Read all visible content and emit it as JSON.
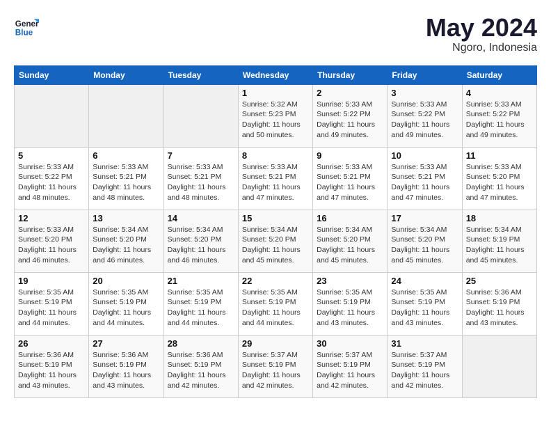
{
  "header": {
    "logo_general": "General",
    "logo_blue": "Blue",
    "month_year": "May 2024",
    "location": "Ngoro, Indonesia"
  },
  "days_of_week": [
    "Sunday",
    "Monday",
    "Tuesday",
    "Wednesday",
    "Thursday",
    "Friday",
    "Saturday"
  ],
  "weeks": [
    [
      {
        "day": "",
        "info": ""
      },
      {
        "day": "",
        "info": ""
      },
      {
        "day": "",
        "info": ""
      },
      {
        "day": "1",
        "info": "Sunrise: 5:32 AM\nSunset: 5:23 PM\nDaylight: 11 hours\nand 50 minutes."
      },
      {
        "day": "2",
        "info": "Sunrise: 5:33 AM\nSunset: 5:22 PM\nDaylight: 11 hours\nand 49 minutes."
      },
      {
        "day": "3",
        "info": "Sunrise: 5:33 AM\nSunset: 5:22 PM\nDaylight: 11 hours\nand 49 minutes."
      },
      {
        "day": "4",
        "info": "Sunrise: 5:33 AM\nSunset: 5:22 PM\nDaylight: 11 hours\nand 49 minutes."
      }
    ],
    [
      {
        "day": "5",
        "info": "Sunrise: 5:33 AM\nSunset: 5:22 PM\nDaylight: 11 hours\nand 48 minutes."
      },
      {
        "day": "6",
        "info": "Sunrise: 5:33 AM\nSunset: 5:21 PM\nDaylight: 11 hours\nand 48 minutes."
      },
      {
        "day": "7",
        "info": "Sunrise: 5:33 AM\nSunset: 5:21 PM\nDaylight: 11 hours\nand 48 minutes."
      },
      {
        "day": "8",
        "info": "Sunrise: 5:33 AM\nSunset: 5:21 PM\nDaylight: 11 hours\nand 47 minutes."
      },
      {
        "day": "9",
        "info": "Sunrise: 5:33 AM\nSunset: 5:21 PM\nDaylight: 11 hours\nand 47 minutes."
      },
      {
        "day": "10",
        "info": "Sunrise: 5:33 AM\nSunset: 5:21 PM\nDaylight: 11 hours\nand 47 minutes."
      },
      {
        "day": "11",
        "info": "Sunrise: 5:33 AM\nSunset: 5:20 PM\nDaylight: 11 hours\nand 47 minutes."
      }
    ],
    [
      {
        "day": "12",
        "info": "Sunrise: 5:33 AM\nSunset: 5:20 PM\nDaylight: 11 hours\nand 46 minutes."
      },
      {
        "day": "13",
        "info": "Sunrise: 5:34 AM\nSunset: 5:20 PM\nDaylight: 11 hours\nand 46 minutes."
      },
      {
        "day": "14",
        "info": "Sunrise: 5:34 AM\nSunset: 5:20 PM\nDaylight: 11 hours\nand 46 minutes."
      },
      {
        "day": "15",
        "info": "Sunrise: 5:34 AM\nSunset: 5:20 PM\nDaylight: 11 hours\nand 45 minutes."
      },
      {
        "day": "16",
        "info": "Sunrise: 5:34 AM\nSunset: 5:20 PM\nDaylight: 11 hours\nand 45 minutes."
      },
      {
        "day": "17",
        "info": "Sunrise: 5:34 AM\nSunset: 5:20 PM\nDaylight: 11 hours\nand 45 minutes."
      },
      {
        "day": "18",
        "info": "Sunrise: 5:34 AM\nSunset: 5:19 PM\nDaylight: 11 hours\nand 45 minutes."
      }
    ],
    [
      {
        "day": "19",
        "info": "Sunrise: 5:35 AM\nSunset: 5:19 PM\nDaylight: 11 hours\nand 44 minutes."
      },
      {
        "day": "20",
        "info": "Sunrise: 5:35 AM\nSunset: 5:19 PM\nDaylight: 11 hours\nand 44 minutes."
      },
      {
        "day": "21",
        "info": "Sunrise: 5:35 AM\nSunset: 5:19 PM\nDaylight: 11 hours\nand 44 minutes."
      },
      {
        "day": "22",
        "info": "Sunrise: 5:35 AM\nSunset: 5:19 PM\nDaylight: 11 hours\nand 44 minutes."
      },
      {
        "day": "23",
        "info": "Sunrise: 5:35 AM\nSunset: 5:19 PM\nDaylight: 11 hours\nand 43 minutes."
      },
      {
        "day": "24",
        "info": "Sunrise: 5:35 AM\nSunset: 5:19 PM\nDaylight: 11 hours\nand 43 minutes."
      },
      {
        "day": "25",
        "info": "Sunrise: 5:36 AM\nSunset: 5:19 PM\nDaylight: 11 hours\nand 43 minutes."
      }
    ],
    [
      {
        "day": "26",
        "info": "Sunrise: 5:36 AM\nSunset: 5:19 PM\nDaylight: 11 hours\nand 43 minutes."
      },
      {
        "day": "27",
        "info": "Sunrise: 5:36 AM\nSunset: 5:19 PM\nDaylight: 11 hours\nand 43 minutes."
      },
      {
        "day": "28",
        "info": "Sunrise: 5:36 AM\nSunset: 5:19 PM\nDaylight: 11 hours\nand 42 minutes."
      },
      {
        "day": "29",
        "info": "Sunrise: 5:37 AM\nSunset: 5:19 PM\nDaylight: 11 hours\nand 42 minutes."
      },
      {
        "day": "30",
        "info": "Sunrise: 5:37 AM\nSunset: 5:19 PM\nDaylight: 11 hours\nand 42 minutes."
      },
      {
        "day": "31",
        "info": "Sunrise: 5:37 AM\nSunset: 5:19 PM\nDaylight: 11 hours\nand 42 minutes."
      },
      {
        "day": "",
        "info": ""
      }
    ]
  ]
}
